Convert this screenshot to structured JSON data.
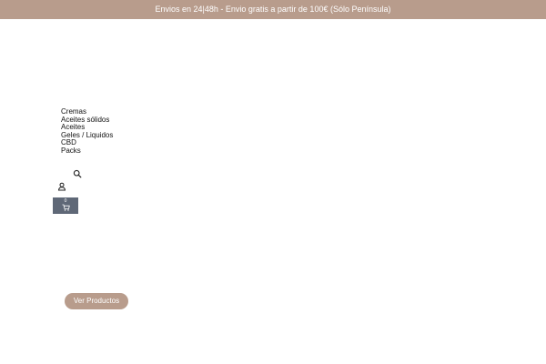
{
  "announcement": {
    "text": "Envios en 24|48h - Envio gratis a partir de 100€ (Sólo Península)"
  },
  "nav": {
    "items": [
      {
        "label": "Cremas"
      },
      {
        "label": "Aceites sólidos"
      },
      {
        "label": "Aceites"
      },
      {
        "label": "Geles / Liquidos"
      },
      {
        "label": "CBD"
      },
      {
        "label": "Packs"
      }
    ]
  },
  "header_icons": {
    "search": "search-icon",
    "account": "user-icon",
    "cart": "cart-icon"
  },
  "cart": {
    "count": "0"
  },
  "cta": {
    "label": "Ver Productos"
  },
  "colors": {
    "brand": "#b89c8c",
    "cart_bg": "#5f6877",
    "text": "#111111"
  }
}
